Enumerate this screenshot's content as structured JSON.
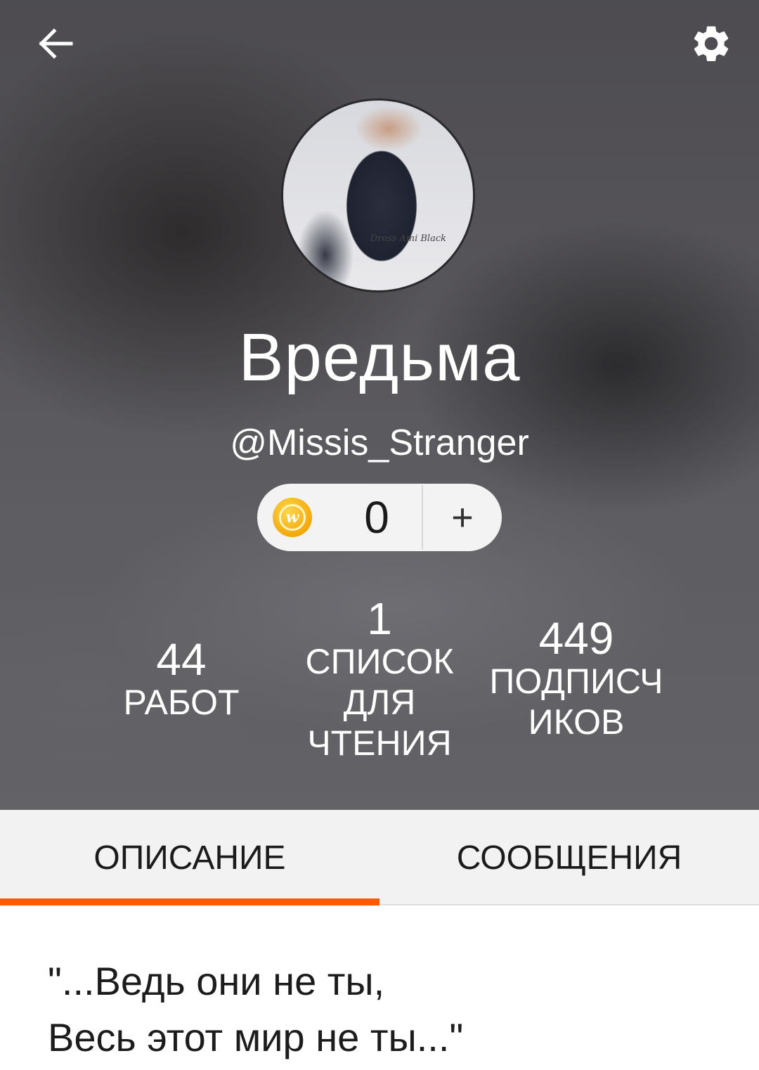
{
  "profile": {
    "display_name": "Вредьма",
    "username": "@Missis_Stranger",
    "avatar_caption": "Dress Ami\nBlack"
  },
  "coins": {
    "count": "0",
    "add_label": "+",
    "coin_letter": "w"
  },
  "stats": {
    "works": {
      "value": "44",
      "label": "РАБОТ"
    },
    "reading_lists": {
      "value": "1",
      "label": "СПИСОК ДЛЯ ЧТЕНИЯ"
    },
    "followers": {
      "value": "449",
      "label": "ПОДПИСЧИКОВ"
    }
  },
  "tabs": [
    {
      "label": "ОПИСАНИЕ",
      "active": true
    },
    {
      "label": "СООБЩЕНИЯ",
      "active": false
    }
  ],
  "description": "\"...Ведь они не ты,\nВесь этот мир не ты...\"",
  "colors": {
    "accent": "#ff5a00",
    "tab_background": "#f2f2f2",
    "coin": "#f4a90c"
  },
  "icons": {
    "back": "arrow-left-icon",
    "settings": "gear-icon",
    "coin": "coin-icon"
  }
}
